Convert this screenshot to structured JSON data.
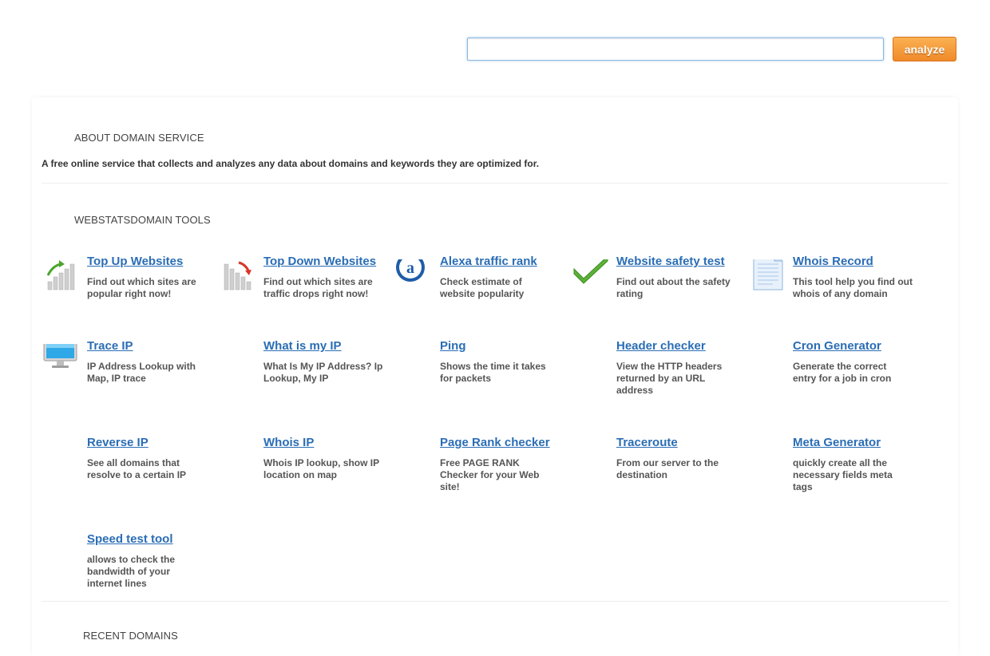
{
  "search": {
    "value": "",
    "placeholder": "",
    "button_label": "analyze"
  },
  "about": {
    "heading": "ABOUT DOMAIN SERVICE",
    "text": "A free online service that collects and analyzes any data about domains and keywords they are optimized for."
  },
  "tools_section": {
    "heading": "WEBSTATSDOMAIN TOOLS"
  },
  "tools": [
    {
      "title": "Top Up Websites",
      "desc": "Find out which sites are popular right now!",
      "icon": "trending-up-chart-icon"
    },
    {
      "title": "Top Down Websites",
      "desc": "Find out which sites are traffic drops right now!",
      "icon": "trending-down-chart-icon"
    },
    {
      "title": "Alexa traffic rank",
      "desc": "Check estimate of website popularity",
      "icon": "alexa-logo-icon"
    },
    {
      "title": "Website safety test",
      "desc": "Find out about the safety rating",
      "icon": "checkmark-icon"
    },
    {
      "title": "Whois Record",
      "desc": "This tool help you find out whois of any domain",
      "icon": "document-icon"
    },
    {
      "title": "Trace IP",
      "desc": "IP Address Lookup with Map, IP trace",
      "icon": "monitor-icon"
    },
    {
      "title": "What is my IP",
      "desc": "What Is My IP Address? Ip Lookup, My IP",
      "icon": ""
    },
    {
      "title": "Ping",
      "desc": "Shows the time it takes for packets",
      "icon": ""
    },
    {
      "title": "Header checker",
      "desc": "View the HTTP headers returned by an URL address",
      "icon": ""
    },
    {
      "title": "Cron Generator",
      "desc": "Generate the correct entry for a job in cron",
      "icon": ""
    },
    {
      "title": "Reverse IP",
      "desc": "See all domains that resolve to a certain IP",
      "icon": ""
    },
    {
      "title": "Whois IP",
      "desc": "Whois IP lookup, show IP location on map",
      "icon": ""
    },
    {
      "title": "Page Rank checker",
      "desc": "Free PAGE RANK Checker for your Web site!",
      "icon": ""
    },
    {
      "title": "Traceroute",
      "desc": "From our server to the destination",
      "icon": ""
    },
    {
      "title": "Meta Generator",
      "desc": "quickly create all the necessary fields meta tags",
      "icon": ""
    },
    {
      "title": "Speed test tool",
      "desc": "allows to check the bandwidth of your internet lines",
      "icon": ""
    }
  ],
  "recent": {
    "heading": "RECENT DOMAINS"
  },
  "colors": {
    "link": "#2a6db5",
    "button": "#ef8a2a"
  }
}
